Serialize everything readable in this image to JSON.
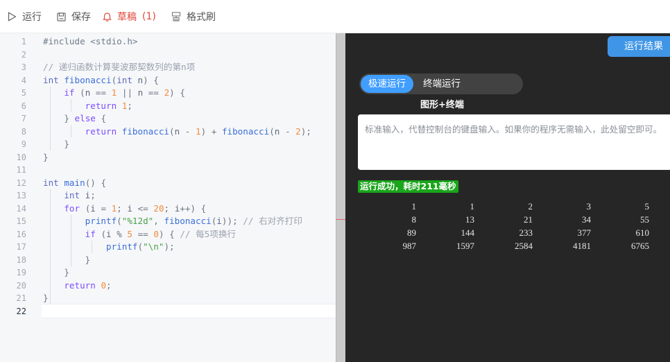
{
  "toolbar": {
    "run_label": "运行",
    "save_label": "保存",
    "draft_label": "草稿",
    "draft_count": "(1)",
    "format_label": "格式刷"
  },
  "editor": {
    "line_numbers": [
      "1",
      "2",
      "3",
      "4",
      "5",
      "6",
      "7",
      "8",
      "9",
      "10",
      "11",
      "12",
      "13",
      "14",
      "15",
      "16",
      "17",
      "18",
      "19",
      "20",
      "21",
      "22"
    ],
    "active_line": "22",
    "lines": [
      "#include <stdio.h>",
      "",
      "// 递归函数计算斐波那契数列的第n项",
      "int fibonacci(int n) {",
      "    if (n == 1 || n == 2) {",
      "        return 1;",
      "    } else {",
      "        return fibonacci(n - 1) + fibonacci(n - 2);",
      "    }",
      "}",
      "",
      "int main() {",
      "    int i;",
      "    for (i = 1; i <= 20; i++) {",
      "        printf(\"%12d\", fibonacci(i)); // 右对齐打印",
      "        if (i % 5 == 0) { // 每5项换行",
      "            printf(\"\\n\");",
      "        }",
      "    }",
      "    return 0;",
      "}",
      ""
    ]
  },
  "run_panel": {
    "result_tab": "运行结果",
    "mode_fast": "极速运行",
    "mode_terminal": "终端运行",
    "mode_graphic": "图形+终端",
    "stdin_placeholder": "标准输入，代替控制台的键盘输入。如果你的程序无需输入，此处留空即可。",
    "status": "运行成功，耗时211毫秒",
    "output_rows": [
      [
        "1",
        "1",
        "2",
        "3",
        "5"
      ],
      [
        "8",
        "13",
        "21",
        "34",
        "55"
      ],
      [
        "89",
        "144",
        "233",
        "377",
        "610"
      ],
      [
        "987",
        "1597",
        "2584",
        "4181",
        "6765"
      ]
    ]
  },
  "colors": {
    "accent": "#409eff",
    "draft": "#e0473b",
    "success": "#1aa51a",
    "panel_bg": "#262626"
  }
}
